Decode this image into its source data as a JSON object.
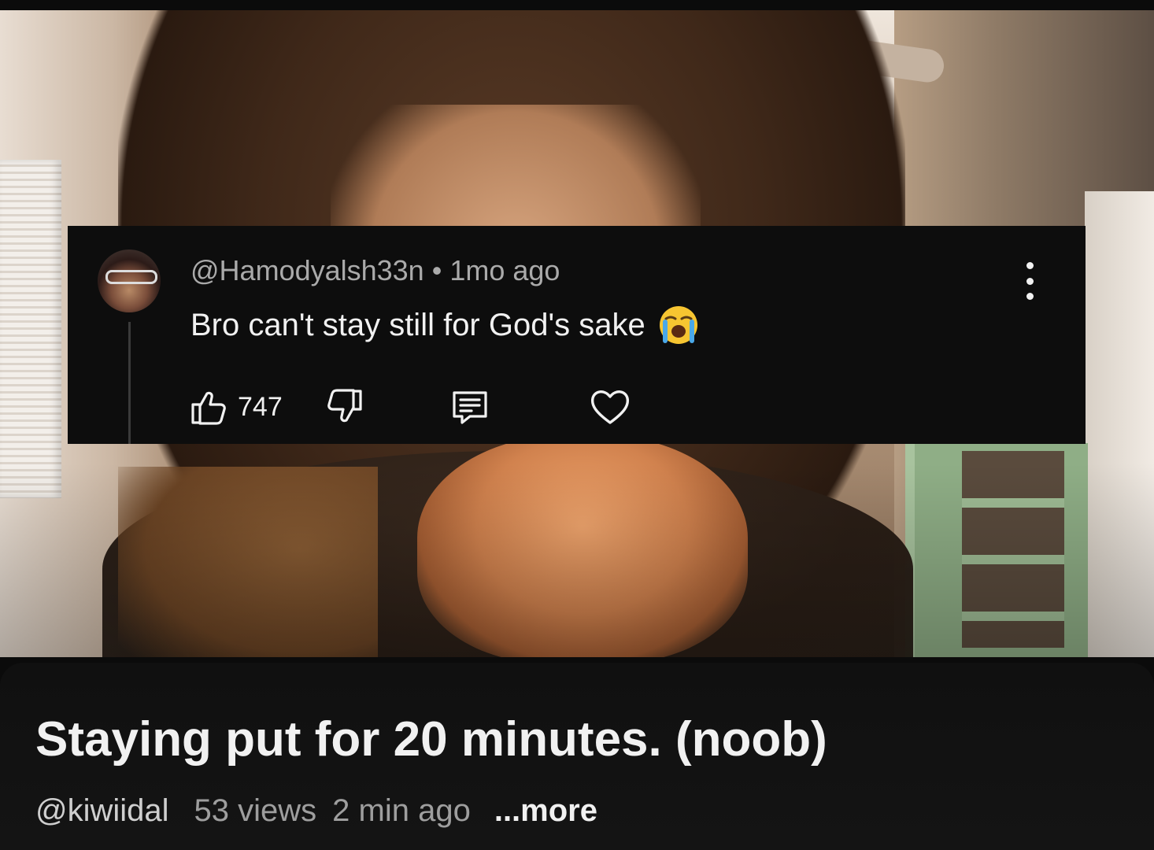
{
  "comment": {
    "username": "@Hamodyalsh33n",
    "separator": "•",
    "timestamp": "1mo ago",
    "text": "Bro can't stay still for God's sake",
    "emoji": "loudly-crying-face",
    "like_count": "747",
    "icons": {
      "like": "thumbs-up-icon",
      "dislike": "thumbs-down-icon",
      "reply": "comment-reply-icon",
      "heart": "heart-icon",
      "menu": "kebab-menu-icon"
    }
  },
  "video": {
    "title": "Staying put for 20 minutes. (noob)",
    "channel": "@kiwiidal",
    "views": "53 views",
    "age": "2 min ago",
    "more_label": "...more"
  },
  "colors": {
    "overlay_bg": "#0d0d0d",
    "text_primary": "#f1f1f1",
    "text_secondary": "#aaaaaa"
  }
}
